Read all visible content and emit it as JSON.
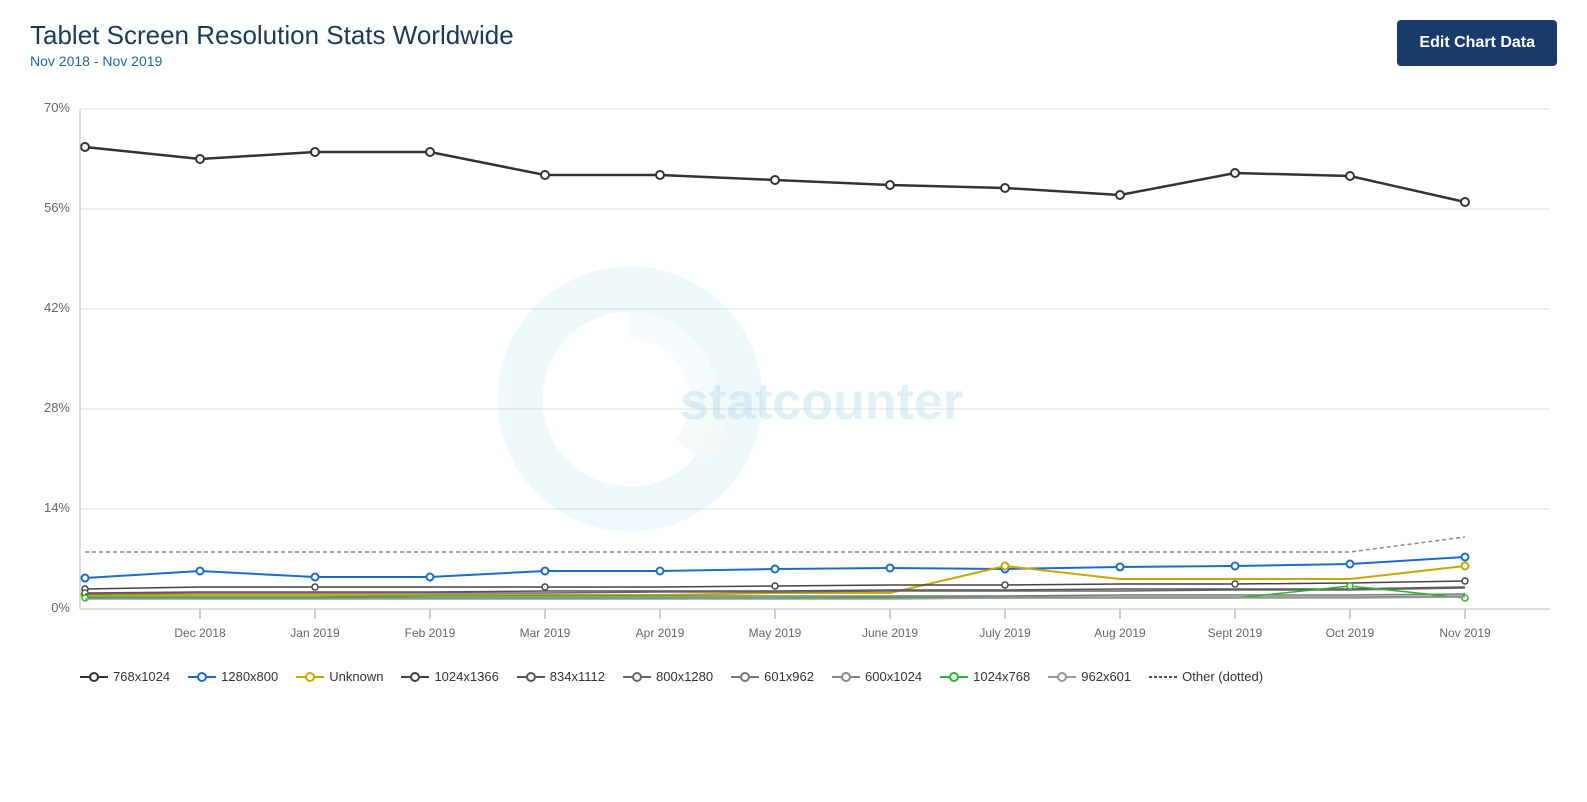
{
  "header": {
    "title": "Tablet Screen Resolution Stats Worldwide",
    "subtitle": "Nov 2018 - Nov 2019",
    "edit_button_label": "Edit Chart Data"
  },
  "chart": {
    "y_axis_labels": [
      "0%",
      "14%",
      "28%",
      "42%",
      "56%",
      "70%"
    ],
    "x_axis_labels": [
      "Dec 2018",
      "Jan 2019",
      "Feb 2019",
      "Mar 2019",
      "Apr 2019",
      "May 2019",
      "June 2019",
      "July 2019",
      "Aug 2019",
      "Sept 2019",
      "Oct 2019",
      "Nov 2019"
    ],
    "watermark": "statcounter"
  },
  "legend": {
    "items": [
      {
        "label": "768x1024",
        "color": "#333",
        "style": "solid",
        "hasCircle": true
      },
      {
        "label": "1280x800",
        "color": "#1a6ccc",
        "style": "solid",
        "hasCircle": true
      },
      {
        "label": "Unknown",
        "color": "#c8a800",
        "style": "solid",
        "hasCircle": true
      },
      {
        "label": "1024x1366",
        "color": "#555",
        "style": "solid",
        "hasCircle": true
      },
      {
        "label": "834x1112",
        "color": "#333",
        "style": "solid",
        "hasCircle": true
      },
      {
        "label": "800x1280",
        "color": "#555",
        "style": "solid",
        "hasCircle": true
      },
      {
        "label": "601x962",
        "color": "#333",
        "style": "solid",
        "hasCircle": true
      },
      {
        "label": "600x1024",
        "color": "#333",
        "style": "solid",
        "hasCircle": true
      },
      {
        "label": "1024x768",
        "color": "#2db52d",
        "style": "solid",
        "hasCircle": true
      },
      {
        "label": "962x601",
        "color": "#333",
        "style": "solid",
        "hasCircle": true
      },
      {
        "label": "Other (dotted)",
        "color": "#555",
        "style": "dotted",
        "hasCircle": false
      }
    ]
  }
}
